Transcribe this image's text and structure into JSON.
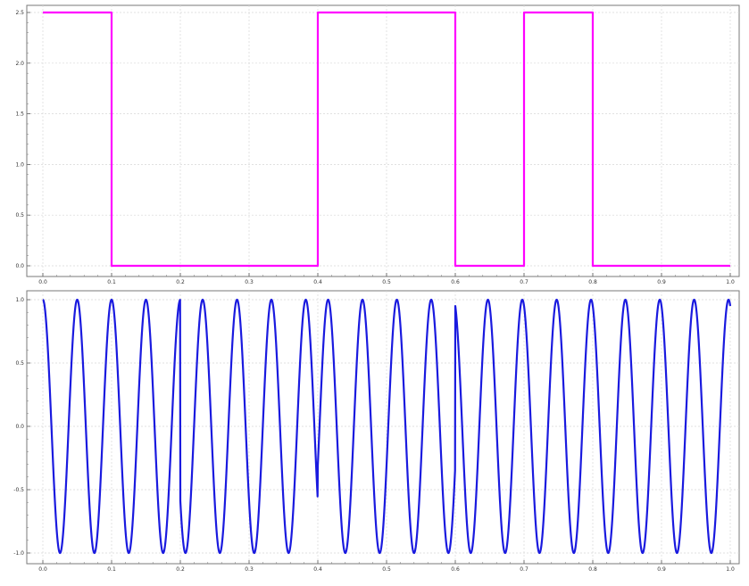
{
  "chart_data": [
    {
      "type": "line",
      "title": "",
      "xlabel": "",
      "ylabel": "",
      "xlim": [
        0.0,
        1.0
      ],
      "ylim": [
        0.0,
        2.5
      ],
      "grid": true,
      "x_ticks": [
        "0.0",
        "0.1",
        "0.2",
        "0.3",
        "0.4",
        "0.5",
        "0.6",
        "0.7",
        "0.8",
        "0.9",
        "1.0"
      ],
      "y_ticks": [
        "0.0",
        "0.5",
        "1.0",
        "1.5",
        "2.0",
        "2.5"
      ],
      "series": [
        {
          "color": "#ff00ff",
          "x": [
            0.0,
            0.1,
            0.1,
            0.4,
            0.4,
            0.6,
            0.6,
            0.7,
            0.7,
            0.8,
            0.8,
            1.0
          ],
          "y": [
            2.5,
            2.5,
            0.0,
            0.0,
            2.5,
            2.5,
            0.0,
            0.0,
            2.5,
            2.5,
            0.0,
            0.0
          ]
        }
      ]
    },
    {
      "type": "line",
      "title": "",
      "xlabel": "",
      "ylabel": "",
      "xlim": [
        0.0,
        1.0
      ],
      "ylim": [
        -1.0,
        1.0
      ],
      "grid": true,
      "x_ticks": [
        "0.0",
        "0.1",
        "0.2",
        "0.3",
        "0.4",
        "0.5",
        "0.6",
        "0.7",
        "0.8",
        "0.9",
        "1.0"
      ],
      "y_ticks": [
        "-1.0",
        "-0.5",
        "0.0",
        "0.5",
        "1.0"
      ],
      "series": [
        {
          "color": "#1a1adf",
          "frequency_hz": 20,
          "amplitude": 1.0,
          "phase_offset": 0.25,
          "phase_jumps_at": [
            0.2,
            0.4,
            0.6
          ],
          "phase_jump_rad": 2.2
        }
      ]
    }
  ]
}
